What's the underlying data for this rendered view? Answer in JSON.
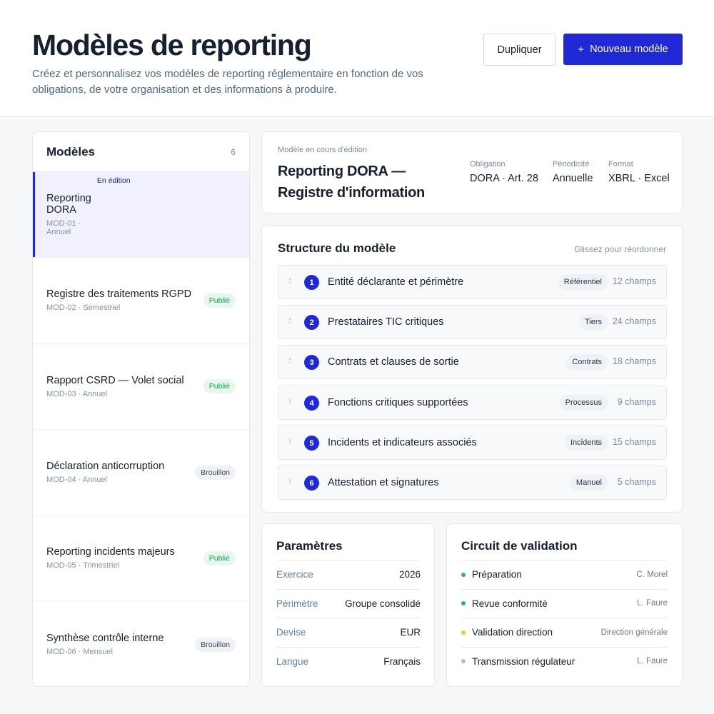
{
  "header": {
    "title": "Modèles de reporting",
    "subtitle": "Créez et personnalisez vos modèles de reporting réglementaire en fonction de vos obligations, de votre organisation et des informations à produire.",
    "duplicate_label": "Dupliquer",
    "new_plus": "+",
    "new_label": "Nouveau modèle"
  },
  "models": {
    "title": "Modèles",
    "count": "6",
    "items": [
      {
        "name": "Reporting DORA",
        "meta": "MOD-01 · Annuel",
        "status": "En édition"
      },
      {
        "name": "Registre des traitements RGPD",
        "meta": "MOD-02 · Semestriel",
        "status": "Publié"
      },
      {
        "name": "Rapport CSRD — Volet social",
        "meta": "MOD-03 · Annuel",
        "status": "Publié"
      },
      {
        "name": "Déclaration anticorruption",
        "meta": "MOD-04 · Annuel",
        "status": "Brouillon"
      },
      {
        "name": "Reporting incidents majeurs",
        "meta": "MOD-05 · Trimestriel",
        "status": "Publié"
      },
      {
        "name": "Synthèse contrôle interne",
        "meta": "MOD-06 · Mensuel",
        "status": "Brouillon"
      }
    ]
  },
  "editing": {
    "kicker": "Modèle en cours d'édition",
    "title": "Reporting DORA — Registre d'information",
    "obligation_label": "Obligation",
    "obligation_value": "DORA · Art. 28",
    "period_label": "Périodicité",
    "period_value": "Annuelle",
    "format_label": "Format",
    "format_value": "XBRL · Excel"
  },
  "structure": {
    "title": "Structure du modèle",
    "hint": "Glissez pour réordonner",
    "sections": [
      {
        "num": "1",
        "name": "Entité déclarante et périmètre",
        "tag": "Référentiel",
        "count": "12 champs"
      },
      {
        "num": "2",
        "name": "Prestataires TIC critiques",
        "tag": "Tiers",
        "count": "24 champs"
      },
      {
        "num": "3",
        "name": "Contrats et clauses de sortie",
        "tag": "Contrats",
        "count": "18 champs"
      },
      {
        "num": "4",
        "name": "Fonctions critiques supportées",
        "tag": "Processus",
        "count": "9 champs"
      },
      {
        "num": "5",
        "name": "Incidents et indicateurs associés",
        "tag": "Incidents",
        "count": "15 champs"
      },
      {
        "num": "6",
        "name": "Attestation et signatures",
        "tag": "Manuel",
        "count": "5 champs"
      }
    ]
  },
  "params": {
    "title": "Paramètres",
    "rows": [
      {
        "k": "Exercice",
        "v": "2026"
      },
      {
        "k": "Périmètre",
        "v": "Groupe consolidé"
      },
      {
        "k": "Devise",
        "v": "EUR"
      },
      {
        "k": "Langue",
        "v": "Français"
      }
    ]
  },
  "validation": {
    "title": "Circuit de validation",
    "steps": [
      {
        "step": "Préparation",
        "who": "C. Morel",
        "color": "#2fb566"
      },
      {
        "step": "Revue conformité",
        "who": "L. Faure",
        "color": "#2fb566"
      },
      {
        "step": "Validation direction",
        "who": "Direction générale",
        "color": "#e9c42a"
      },
      {
        "step": "Transmission régulateur",
        "who": "L. Faure",
        "color": "#b5bcc4"
      }
    ]
  },
  "colors": {
    "accent": "#2128d6",
    "published": "#1e9a52",
    "draft": "#3a4756"
  }
}
